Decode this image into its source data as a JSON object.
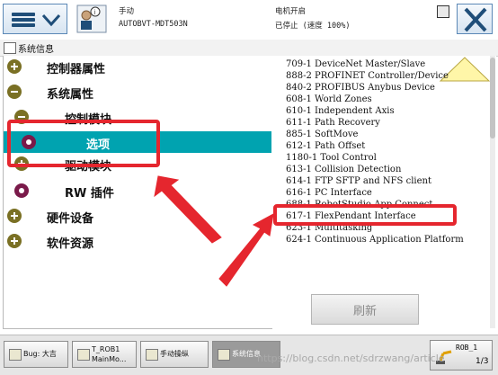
{
  "topbar": {
    "mode": "手动",
    "controller_name": "AUTOBVT-MDT503N",
    "motor_state": "电机开启",
    "run_state": "已停止 (速度 100%)"
  },
  "page": {
    "title": "系统信息"
  },
  "tree": [
    {
      "label": "控制器属性",
      "expander": "plus"
    },
    {
      "label": "系统属性",
      "expander": "minus"
    },
    {
      "label": "控制模块",
      "expander": "minus"
    },
    {
      "label": "选项",
      "expander": "leaf",
      "selected": true
    },
    {
      "label": "驱动模块",
      "expander": "plus"
    },
    {
      "label": "RW 插件",
      "expander": "leaf"
    },
    {
      "label": "硬件设备",
      "expander": "plus"
    },
    {
      "label": "软件资源",
      "expander": "plus"
    }
  ],
  "options": [
    "709-1 DeviceNet Master/Slave",
    "888-2 PROFINET Controller/Device",
    "840-2 PROFIBUS Anybus Device",
    "608-1 World Zones",
    "610-1 Independent Axis",
    "611-1 Path Recovery",
    "885-1 SoftMove",
    "612-1 Path Offset",
    "1180-1 Tool Control",
    "613-1 Collision Detection",
    "614-1 FTP SFTP and NFS client",
    "616-1 PC Interface",
    "688-1 RobotStudio App Connect",
    "617-1 FlexPendant Interface",
    "623-1 Multitasking",
    "624-1 Continuous Application Platform"
  ],
  "refresh_button": "刷新",
  "taskbar": [
    {
      "label": "Bug: 大吉",
      "line2": ""
    },
    {
      "label": "T_ROB1",
      "line2": "MainMo..."
    },
    {
      "label": "手动操纵",
      "line2": ""
    },
    {
      "label": "系统信息",
      "line2": ""
    }
  ],
  "rob_badge": {
    "label": "ROB_1",
    "speed": "1/3"
  },
  "watermark": "https://blog.csdn.net/sdrzwang/article",
  "colors": {
    "selection": "#00a3b0",
    "annotation": "#e5262e",
    "expander": "#7a7024",
    "leaf": "#7a1a4a"
  }
}
